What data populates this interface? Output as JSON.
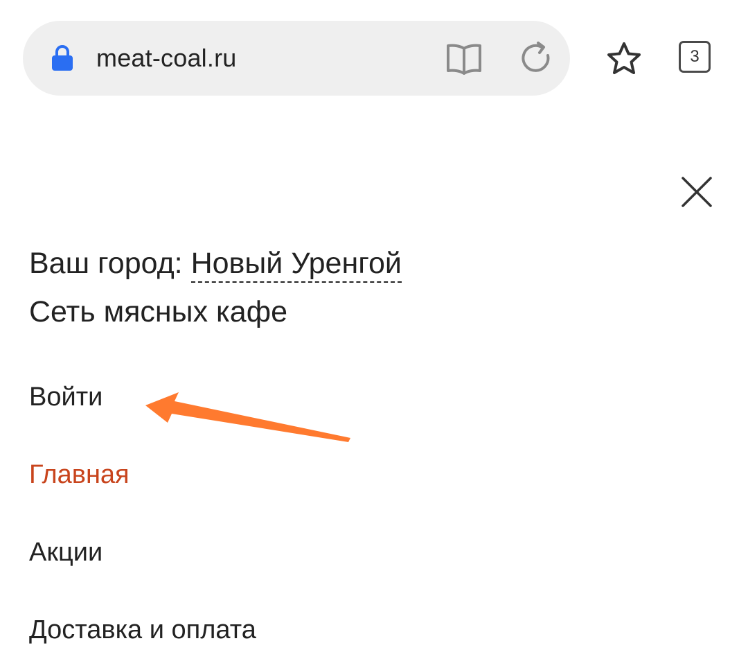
{
  "browser": {
    "url": "meat-coal.ru",
    "tab_count": "3",
    "icons": {
      "lock": "lock-icon",
      "reader": "reader-mode-icon",
      "reload": "reload-icon",
      "bookmark": "star-icon",
      "tabs": "tabs-icon"
    }
  },
  "menu": {
    "city_label": "Ваш город:",
    "city_name": "Новый Уренгой",
    "tagline": "Сеть мясных кафе",
    "items": [
      {
        "label": "Войти",
        "active": false
      },
      {
        "label": "Главная",
        "active": true
      },
      {
        "label": "Акции",
        "active": false
      },
      {
        "label": "Доставка и оплата",
        "active": false
      }
    ]
  },
  "colors": {
    "lock": "#2a6ef2",
    "active_item": "#c8441c",
    "arrow": "#ff7a2f",
    "address_bar_bg": "#efefef"
  }
}
